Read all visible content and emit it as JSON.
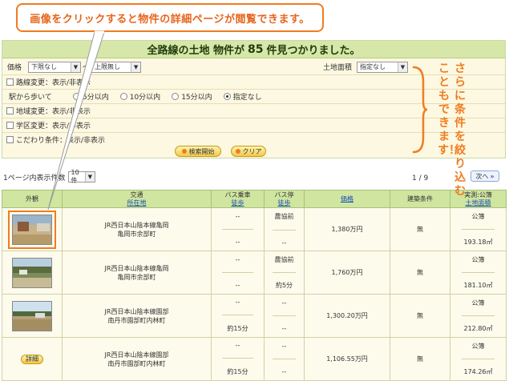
{
  "callout": {
    "text": "画像をクリックすると物件の詳細ページが閲覧できます。"
  },
  "panel": {
    "heading_prefix": "全路線の土地 物件が",
    "heading_count": "85",
    "heading_suffix": "件見つかりました。",
    "price_label": "価格",
    "price_min": "下限なし",
    "price_tilde": "〜",
    "price_max": "上限無し",
    "area_label": "土地面積",
    "area_value": "指定なし",
    "route_change": "路線変更：表示/非表示",
    "walk_label": "駅から歩いて",
    "walk_options": [
      "5分以内",
      "10分以内",
      "15分以内",
      "指定なし"
    ],
    "region_change": "地域変更：表示/非表示",
    "school_change": "学区変更：表示/非表示",
    "kodawari_change": "こだわり条件：表示/非表示",
    "search_btn": "検索開始",
    "clear_btn": "クリア"
  },
  "vertical_note": [
    "さらに条件を絞り込む",
    "こともできます！"
  ],
  "paging": {
    "per_page_label": "1ページ内表示件数",
    "per_page_value": "10件",
    "page_info": "1 / 9",
    "next_label": "次へ"
  },
  "table": {
    "headers": {
      "photo": "外観",
      "transit": "交通",
      "transit_link": "所在地",
      "bus_ride": "バス乗車",
      "bus_ride_link": "徒歩",
      "bus_stop": "バス停",
      "bus_stop_link": "徒歩",
      "price": "価格",
      "building": "建築条件",
      "area": "実測:公簿",
      "area_link": "土地面積"
    },
    "rows": [
      {
        "line": "JR西日本山陰本線亀岡",
        "address": "亀岡市余部町",
        "bus_top": "--",
        "bus_bottom": "--",
        "stop_top": "農協前",
        "stop_bottom": "--",
        "price": "1,380万円",
        "building": "無",
        "area_top": "公簿",
        "area_bottom": "193.18㎡",
        "photo": "thumb"
      },
      {
        "line": "JR西日本山陰本線亀岡",
        "address": "亀岡市余部町",
        "bus_top": "--",
        "bus_bottom": "--",
        "stop_top": "農協前",
        "stop_bottom": "約5分",
        "price": "1,760万円",
        "building": "無",
        "area_top": "公簿",
        "area_bottom": "181.10㎡",
        "photo": "thumb"
      },
      {
        "line": "JR西日本山陰本線園部",
        "address": "南丹市園部町内林町",
        "bus_top": "--",
        "bus_bottom": "約15分",
        "stop_top": "--",
        "stop_bottom": "--",
        "price": "1,300.20万円",
        "building": "無",
        "area_top": "公簿",
        "area_bottom": "212.80㎡",
        "photo": "thumb"
      },
      {
        "line": "JR西日本山陰本線園部",
        "address": "南丹市園部町内林町",
        "bus_top": "--",
        "bus_bottom": "約15分",
        "stop_top": "--",
        "stop_bottom": "--",
        "price": "1,106.55万円",
        "building": "無",
        "area_top": "公簿",
        "area_bottom": "174.26㎡",
        "photo": "詳細"
      }
    ]
  },
  "colors": {
    "accent": "#f07c21",
    "header_green": "#d6e7a9",
    "panel_bg": "#fdf8e1"
  }
}
